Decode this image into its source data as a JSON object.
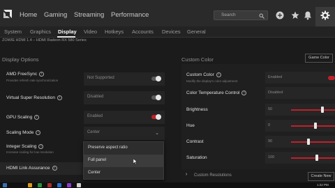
{
  "nav": {
    "items": [
      "Home",
      "Gaming",
      "Streaming",
      "Performance"
    ],
    "search_placeholder": "Search"
  },
  "subtabs": {
    "items": [
      "System",
      "Graphics",
      "Display",
      "Video",
      "Hotkeys",
      "Accounts",
      "Devices",
      "General"
    ],
    "active": "Display"
  },
  "device_line": "ZOWIE HDMI 1.4 – HDMI Radeon RX 580 Series",
  "display_options": {
    "title": "Display Options",
    "freesync": {
      "label": "AMD FreeSync",
      "sub": "Provides refresh rate synchronization",
      "value": "Not Supported"
    },
    "vsr": {
      "label": "Virtual Super Resolution",
      "value": "Disabled"
    },
    "gpu_scaling": {
      "label": "GPU Scaling",
      "value": "Enabled"
    },
    "scaling_mode": {
      "label": "Scaling Mode",
      "value": "Center"
    },
    "integer_scaling": {
      "label": "Integer Scaling",
      "sub": "Increase scaling for low resolution"
    },
    "hdmi": {
      "label": "HDMI Link Assurance"
    }
  },
  "scaling_dropdown": {
    "options": [
      "Preserve aspect ratio",
      "Full panel",
      "Center"
    ],
    "hovered": "Full panel"
  },
  "custom_color": {
    "title": "Custom Color",
    "reset_label": "Game Color",
    "custom_color": {
      "label": "Custom Color",
      "sub": "Modify the display's color adjustment",
      "value": "Enabled"
    },
    "temp_control": {
      "label": "Color Temperature Control",
      "value": "Disabled"
    },
    "brightness": {
      "label": "Brightness",
      "value": "50",
      "level": 0.71
    },
    "hue": {
      "label": "Hue",
      "value": "0",
      "level": 0.56
    },
    "contrast": {
      "label": "Contrast",
      "value": "90",
      "level": 0.4
    },
    "saturation": {
      "label": "Saturation",
      "value": "100",
      "level": 0.59
    }
  },
  "custom_resolutions": {
    "label": "Custom Resolutions",
    "button": "Create New"
  },
  "taskbar": {
    "clock": "1:22 PM"
  },
  "colors": {
    "accent": "#c0202a",
    "background": "#1b1b1b"
  }
}
